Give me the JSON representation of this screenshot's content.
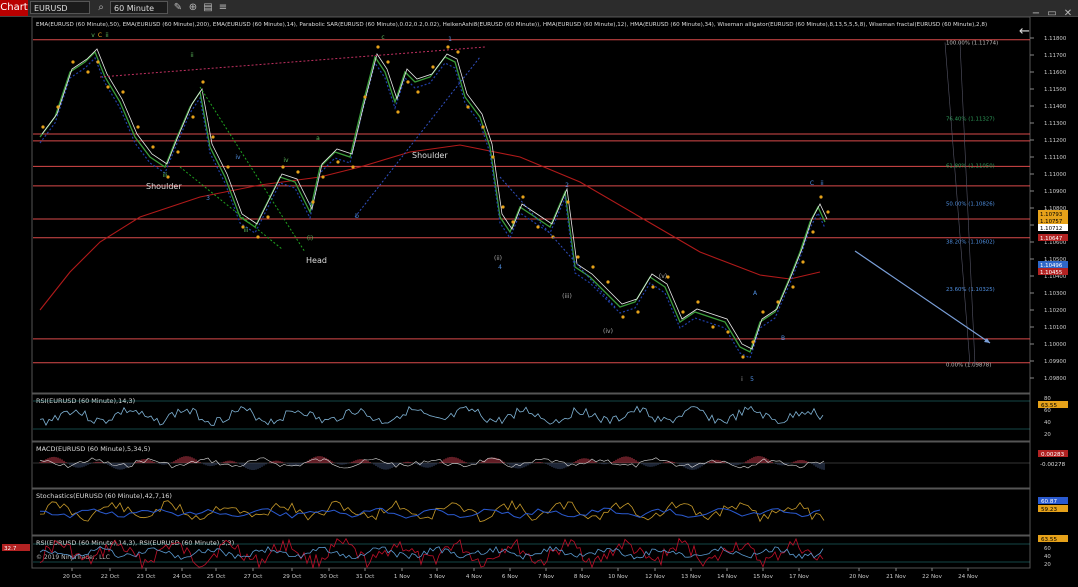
{
  "toolbar": {
    "chart_tab": "Chart",
    "symbol": "EURUSD",
    "period": "60 Minute",
    "minimize": "−",
    "restore": "▭",
    "close": "✕"
  },
  "colors": {
    "background": "#000000",
    "panel_border": "#555555",
    "price_up_label": "#e6a21a",
    "price_dn_label": "#b22222",
    "level_line": "#d94a4a",
    "rsi": "#7fb3d5",
    "fib": "#4f8fe0"
  },
  "price_panel": {
    "indicator_header": "EMA(EURUSD (60 Minute),50), EMA(EURUSD (60 Minute),200), EMA(EURUSD (60 Minute),14), Parabolic SAR(EURUSD (60 Minute),0.02,0.2,0.02), HeikenAshi8(EURUSD (60 Minute)), HMA(EURUSD (60 Minute),12), HMA(EURUSD (60 Minute),34), Wiseman alligator(EURUSD (60 Minute),8,13,5,5,5,8), Wiseman fractal(EURUSD (60 Minute),2,8)",
    "y_ticks": [
      "1.11800",
      "1.11700",
      "1.11600",
      "1.11500",
      "1.11400",
      "1.11300",
      "1.11200",
      "1.11100",
      "1.11000",
      "1.10900",
      "1.10800",
      "1.10700",
      "1.10600",
      "1.10500",
      "1.10400",
      "1.10300",
      "1.10200",
      "1.10100",
      "1.10000",
      "1.09900",
      "1.09800"
    ],
    "price_labels": [
      {
        "text": "1.10793",
        "kind": "up"
      },
      {
        "text": "1.10757",
        "kind": "up"
      },
      {
        "text": "1.10712",
        "kind": "current"
      },
      {
        "text": "1.10647",
        "kind": "dn"
      },
      {
        "text": "1.10496",
        "kind": "blue"
      },
      {
        "text": "1.10455",
        "kind": "dn"
      }
    ],
    "fib_labels": [
      "100.00% (1.11774)",
      "76.40% (1.11327)",
      "61.80% (1.11050)",
      "50.00% (1.10826)",
      "38.20% (1.10602)",
      "23.60% (1.10325)",
      "0.00% (1.09878)"
    ],
    "wave_labels": [
      "v",
      "C",
      "ii",
      "iii",
      "iv",
      "(i)",
      "(ii)",
      "(iii)",
      "(iv)",
      "(v)",
      "i",
      "ii",
      "iii",
      "iv",
      "v",
      "a",
      "b",
      "c",
      "C",
      "ii",
      "A",
      "B",
      "1",
      "2",
      "3",
      "4",
      "5"
    ],
    "annotations": [
      "Shoulder",
      "Head",
      "Shoulder"
    ]
  },
  "rsi_panel": {
    "header": "RSI(EURUSD (60 Minute),14,3)",
    "value": "63.55",
    "ticks": [
      "80",
      "60",
      "40",
      "20"
    ]
  },
  "macd_panel": {
    "header": "MACD(EURUSD (60 Minute),5,34,5)",
    "values": [
      "0.00283",
      "-0.00278"
    ]
  },
  "stoch_panel": {
    "header": "Stochastics(EURUSD (60 Minute),42,7,16)",
    "values": [
      "60.87",
      "59.23"
    ]
  },
  "rsi2_panel": {
    "header": "RSI(EURUSD (60 Minute),14,3), RSI(EURUSD (60 Minute),3,3)",
    "values": [
      "63.55",
      "32.7"
    ],
    "ticks": [
      "60",
      "40",
      "20"
    ]
  },
  "copyright": "© 2019 NinjaTrader, LLC",
  "x_labels": [
    "20 Oct",
    "22 Oct",
    "23 Oct",
    "24 Oct",
    "25 Oct",
    "27 Oct",
    "29 Oct",
    "30 Oct",
    "31 Oct",
    "1 Nov",
    "3 Nov",
    "4 Nov",
    "6 Nov",
    "7 Nov",
    "8 Nov",
    "10 Nov",
    "12 Nov",
    "13 Nov",
    "14 Nov",
    "15 Nov",
    "17 Nov",
    "20 Nov",
    "21 Nov",
    "22 Nov",
    "24 Nov"
  ]
}
